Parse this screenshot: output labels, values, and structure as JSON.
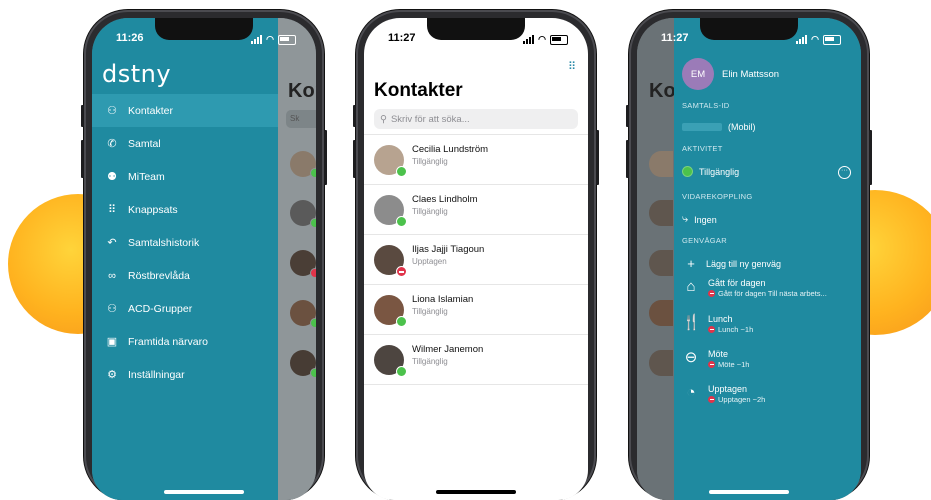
{
  "left_phone": {
    "time": "11:26",
    "logo": "dstny",
    "nav": [
      {
        "label": "Kontakter",
        "icon": "person-icon",
        "glyph": "⚇"
      },
      {
        "label": "Samtal",
        "icon": "phone-icon",
        "glyph": "✆"
      },
      {
        "label": "MiTeam",
        "icon": "team-icon",
        "glyph": "⚉"
      },
      {
        "label": "Knappsats",
        "icon": "keypad-icon",
        "glyph": "⠿"
      },
      {
        "label": "Samtalshistorik",
        "icon": "history-icon",
        "glyph": "↶"
      },
      {
        "label": "Röstbrevlåda",
        "icon": "voicemail-icon",
        "glyph": "∞"
      },
      {
        "label": "ACD-Grupper",
        "icon": "group-icon",
        "glyph": "⚇"
      },
      {
        "label": "Framtida närvaro",
        "icon": "calendar-icon",
        "glyph": "▣"
      },
      {
        "label": "Inställningar",
        "icon": "gear-icon",
        "glyph": "⚙"
      }
    ],
    "peek_title": "Kont",
    "peek_search": "Sk"
  },
  "middle_phone": {
    "time": "11:27",
    "title": "Kontakter",
    "search_placeholder": "Skriv för att söka...",
    "contacts": [
      {
        "name": "Cecilia Lundström",
        "status": "Tillgänglig",
        "state": "available"
      },
      {
        "name": "Claes Lindholm",
        "status": "Tillgänglig",
        "state": "available"
      },
      {
        "name": "Iljas Jajji Tiagoun",
        "status": "Upptagen",
        "state": "busy"
      },
      {
        "name": "Liona Islamian",
        "status": "Tillgänglig",
        "state": "available"
      },
      {
        "name": "Wilmer Janemon",
        "status": "Tillgänglig",
        "state": "available"
      }
    ]
  },
  "right_phone": {
    "time": "11:27",
    "peek_title": "Ko",
    "user_initials": "EM",
    "user_name": "Elin Mattsson",
    "call_id_label": "SAMTALS-ID",
    "call_id_suffix": "(Mobil)",
    "activity_label": "AKTIVITET",
    "activity_value": "Tillgänglig",
    "forwarding_label": "VIDAREKOPPLING",
    "forwarding_value": "Ingen",
    "shortcuts_label": "GENVÄGAR",
    "add_shortcut": "Lägg till ny genväg",
    "shortcuts": [
      {
        "title": "Gått för dagen",
        "sub": "Gått för dagen Till nästa arbets...",
        "icon": "home-icon",
        "glyph": "⌂"
      },
      {
        "title": "Lunch",
        "sub": "Lunch ~1h",
        "icon": "cutlery-icon",
        "glyph": "🍴"
      },
      {
        "title": "Möte",
        "sub": "Möte ~1h",
        "icon": "minus-circle-icon",
        "glyph": "⊖"
      },
      {
        "title": "Upptagen",
        "sub": "Upptagen ~2h",
        "icon": "pie-clock-icon",
        "glyph": "◔"
      }
    ]
  },
  "colors": {
    "teal": "#1f8aa0",
    "available": "#4cc24c",
    "busy": "#e0344a",
    "orange": "#ffb31f"
  }
}
